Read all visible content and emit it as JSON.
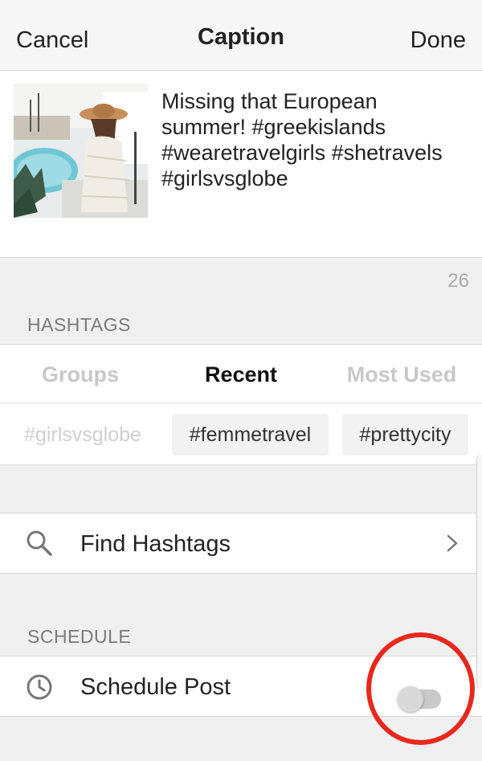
{
  "header": {
    "cancel_label": "Cancel",
    "title": "Caption",
    "done_label": "Done"
  },
  "caption": {
    "lines": [
      "Missing that European",
      "summer! #greekislands",
      "#wearetravelgirls #shetravels",
      "#girlsvsglobe"
    ],
    "char_count": "26"
  },
  "hashtags": {
    "section_label": "HASHTAGS",
    "tabs": [
      {
        "label": "Groups",
        "active": false
      },
      {
        "label": "Recent",
        "active": true
      },
      {
        "label": "Most Used",
        "active": false
      }
    ],
    "chips": [
      {
        "label": "#girlsvsglobe",
        "state": "faded"
      },
      {
        "label": "#femmetravel",
        "state": "filled"
      },
      {
        "label": "#prettycity",
        "state": "filled"
      }
    ],
    "find_label": "Find Hashtags"
  },
  "schedule": {
    "section_label": "SCHEDULE",
    "row_label": "Schedule Post",
    "toggle_on": false
  },
  "colors": {
    "highlight_ring": "#e8281e",
    "inactive_tab": "#c8c8c8",
    "active_tab": "#111111"
  },
  "icons": {
    "search": "search-icon",
    "chevron": "chevron-right-icon",
    "clock": "clock-icon"
  }
}
